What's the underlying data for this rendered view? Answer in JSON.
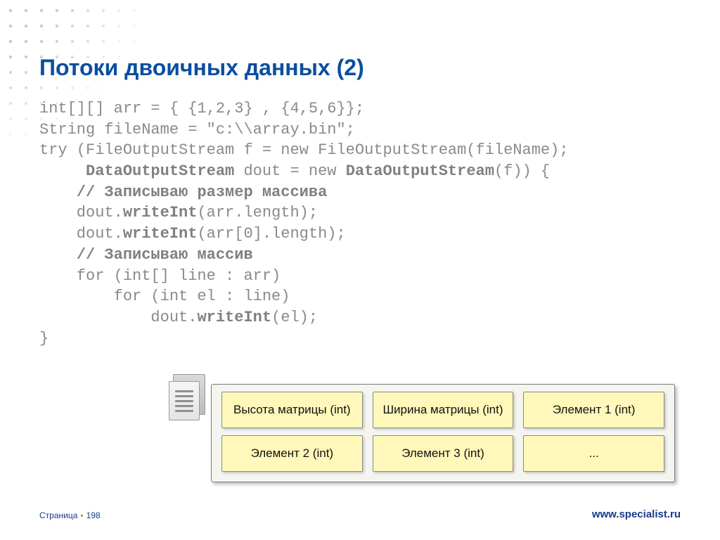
{
  "title": "Потоки двоичных данных (2)",
  "code": {
    "l1": "int[][] arr = { {1,2,3} , {4,5,6}};",
    "l2": "String fileName = \"c:\\\\array.bin\";",
    "l3": "try (FileOutputStream f = new FileOutputStream(fileName);",
    "l4a": "     ",
    "l4b": "DataOutputStream",
    "l4c": " dout = new ",
    "l4d": "DataOutputStream",
    "l4e": "(f)) {",
    "l5a": "    ",
    "l5b": "// Записываю размер массива",
    "l6a": "    dout.",
    "l6b": "writeInt",
    "l6c": "(arr.length);",
    "l7a": "    dout.",
    "l7b": "writeInt",
    "l7c": "(arr[0].length);",
    "l8a": "    ",
    "l8b": "// Записываю массив",
    "l9": "    for (int[] line : arr)",
    "l10": "        for (int el : line)",
    "l11a": "            dout.",
    "l11b": "writeInt",
    "l11c": "(el);",
    "l12": "}"
  },
  "diagram": {
    "cells": [
      "Высота матрицы (int)",
      "Ширина матрицы (int)",
      "Элемент 1 (int)",
      "Элемент 2 (int)",
      "Элемент 3 (int)",
      "..."
    ]
  },
  "footer": {
    "page_label": "Страница",
    "page_number": "198",
    "url": "www.specialist.ru"
  }
}
